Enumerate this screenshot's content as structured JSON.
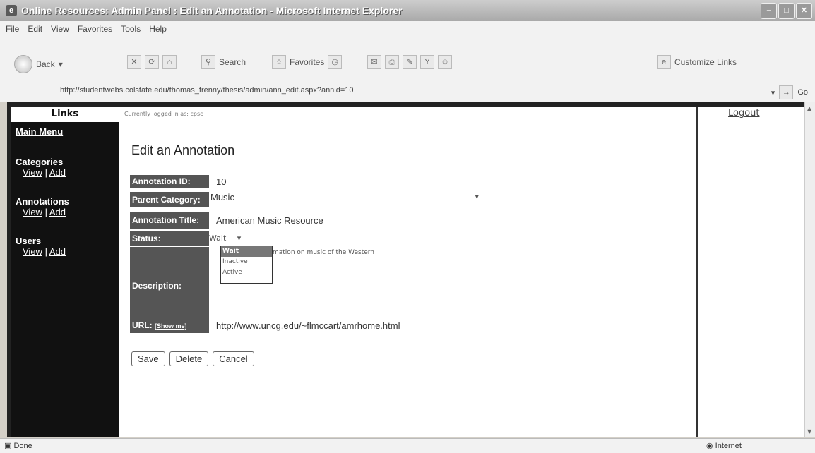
{
  "window": {
    "title": "Online Resources: Admin Panel : Edit an Annotation - Microsoft Internet Explorer"
  },
  "menu": [
    "File",
    "Edit",
    "View",
    "Favorites",
    "Tools",
    "Help"
  ],
  "toolbar": {
    "back": "Back",
    "search": "Search",
    "favorites": "Favorites",
    "customize": "Customize Links"
  },
  "address": {
    "url": "http://studentwebs.colstate.edu/thomas_frenny/thesis/admin/ann_edit.aspx?annid=10",
    "go": "Go"
  },
  "sidebar": {
    "header": "Links",
    "main_menu": "Main Menu",
    "sections": [
      {
        "title": "Categories",
        "view": "View",
        "sep": "|",
        "add": "Add"
      },
      {
        "title": "Annotations",
        "view": "View",
        "sep": "|",
        "add": "Add"
      },
      {
        "title": "Users",
        "view": "View",
        "sep": "|",
        "add": "Add"
      }
    ]
  },
  "main": {
    "logged_in": "Currently logged in as: cpsc",
    "heading": "Edit an Annotation",
    "labels": {
      "id": "Annotation ID:",
      "parent": "Parent Category:",
      "title": "Annotation Title:",
      "status": "Status:",
      "description": "Description:",
      "url": "URL:",
      "show_me": "[Show me]"
    },
    "values": {
      "id": "10",
      "parent": "Music",
      "title": "American Music Resource",
      "status": "Wait",
      "description": "mation on music of the Western",
      "url": "http://www.uncg.edu/~flmccart/amrhome.html"
    },
    "status_options": [
      "Wait",
      "Inactive",
      "Active"
    ],
    "buttons": {
      "save": "Save",
      "delete": "Delete",
      "cancel": "Cancel"
    }
  },
  "right": {
    "logout": "Logout"
  },
  "statusbar": {
    "left": "Done",
    "right": "Internet"
  }
}
